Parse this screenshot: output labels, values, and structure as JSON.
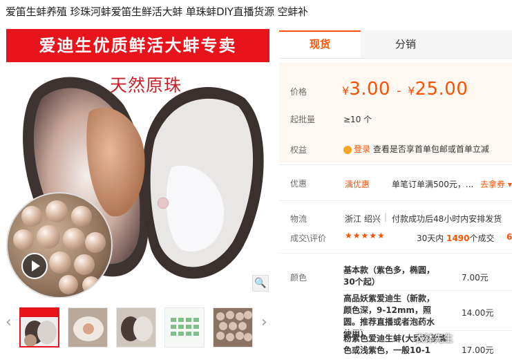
{
  "page": {
    "title": "爱笛生蚌养殖 珍珠河蚌爱笛生鲜活大蚌 单珠蚌DIY直播货源 空蚌补"
  },
  "gallery": {
    "banner_text": "爱迪生优质鲜活大蚌专卖",
    "overlay_text": "天然原珠",
    "play_icon": "play-icon",
    "zoom_icon": "magnifier-icon",
    "thumbnail_count": 5
  },
  "tabs": [
    {
      "label": "现货",
      "active": true
    },
    {
      "label": "分销",
      "active": false
    }
  ],
  "details": {
    "price_label": "价格",
    "price_currency": "¥",
    "price_low": "3.00",
    "price_dash": "-",
    "price_high": "25.00",
    "moq_label": "起批量",
    "moq_value": "≥10 个",
    "rights_label": "权益",
    "rights_login": "登录",
    "rights_text": "查看是否享首单包邮或首单立减",
    "promo_label": "优惠",
    "promo_badge": "满优惠",
    "promo_text": "单笔订单满500元，...",
    "promo_link": "去拿券",
    "logistics_label": "物流",
    "logistics_origin": "浙江 绍兴",
    "logistics_divider": "|",
    "logistics_text": "付款成功后48小时内安排发货",
    "reviews_label": "成交\\评价",
    "stars": "★★★★★",
    "sales_prefix": "30天内",
    "sales_count": "1490",
    "sales_suffix": "个成交",
    "reviews_more": "6",
    "color_label": "颜色"
  },
  "options": [
    {
      "name": "基本款（紫色多，椭圆，30个起）",
      "price": "7.00元"
    },
    {
      "name": "高品妖紫爱迪生（新款，颜色深，9-12mm，照圆。推荐直播或者泡药水使用）",
      "price": "14.00元"
    },
    {
      "name": "粉紫色爱迪生蚌(大致为粉紫色或浅紫色，一般10-1",
      "price": "17.00元"
    }
  ],
  "watermark": "衣钵先生",
  "colors": {
    "accent": "#ff5000",
    "banner_red": "#e8141c",
    "price_bg": "#fff7f2"
  }
}
